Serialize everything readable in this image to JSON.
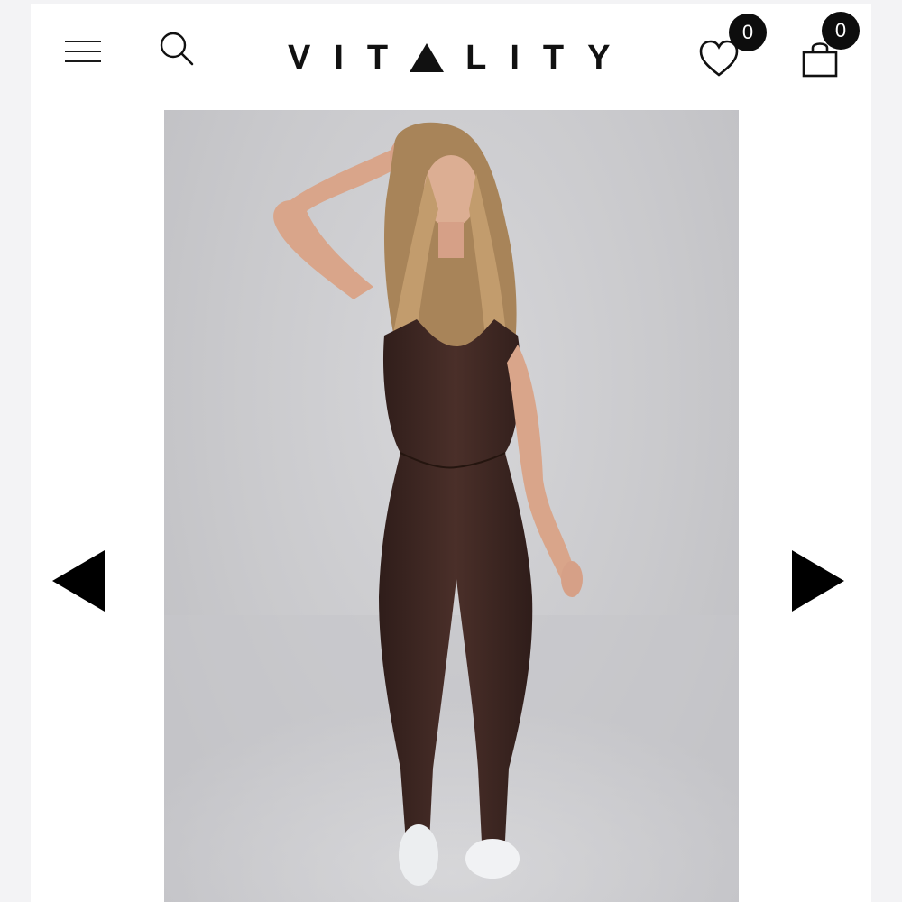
{
  "header": {
    "brand": "VIT",
    "brand_rest": "LITY",
    "wishlist_count": "0",
    "cart_count": "0"
  },
  "gallery": {
    "image_subject": "model-wearing-brown-jumpsuit"
  },
  "colors": {
    "accent": "#000000",
    "jumpsuit": "#3b2521",
    "background": "#c9c9cc"
  }
}
